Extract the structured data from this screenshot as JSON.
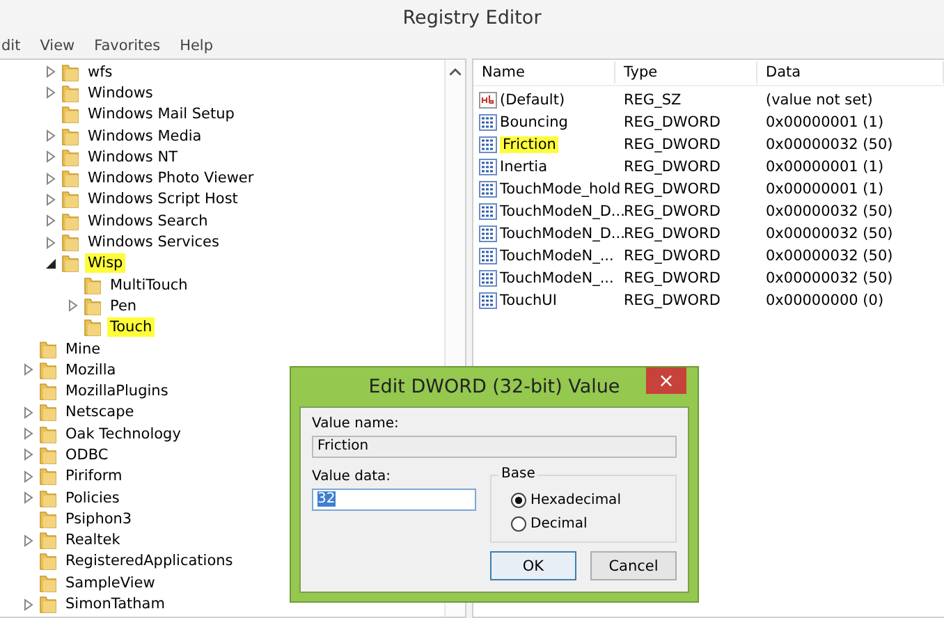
{
  "window": {
    "title": "Registry Editor"
  },
  "menu": [
    "dit",
    "View",
    "Favorites",
    "Help"
  ],
  "tree": {
    "continued_children": [
      {
        "label": "wfs",
        "expanded": false,
        "highlighted": false
      },
      {
        "label": "Windows",
        "expanded": false,
        "highlighted": false
      },
      {
        "label": "Windows Mail Setup",
        "highlighted": false
      },
      {
        "label": "Windows Media",
        "expanded": false,
        "highlighted": false
      },
      {
        "label": "Windows NT",
        "expanded": false,
        "highlighted": false
      },
      {
        "label": "Windows Photo Viewer",
        "expanded": false,
        "highlighted": false
      },
      {
        "label": "Windows Script Host",
        "expanded": false,
        "highlighted": false
      },
      {
        "label": "Windows Search",
        "expanded": false,
        "highlighted": false
      },
      {
        "label": "Windows Services",
        "expanded": false,
        "highlighted": false
      },
      {
        "label": "Wisp",
        "expanded": true,
        "highlighted": true,
        "children": [
          {
            "label": "MultiTouch",
            "highlighted": false
          },
          {
            "label": "Pen",
            "expanded": false,
            "highlighted": false
          },
          {
            "label": "Touch",
            "highlighted": true
          }
        ]
      }
    ],
    "items": [
      {
        "label": "Mine",
        "highlighted": false
      },
      {
        "label": "Mozilla",
        "expanded": false,
        "highlighted": false
      },
      {
        "label": "MozillaPlugins",
        "highlighted": false
      },
      {
        "label": "Netscape",
        "expanded": false,
        "highlighted": false
      },
      {
        "label": "Oak Technology",
        "expanded": false,
        "highlighted": false
      },
      {
        "label": "ODBC",
        "expanded": false,
        "highlighted": false
      },
      {
        "label": "Piriform",
        "expanded": false,
        "highlighted": false
      },
      {
        "label": "Policies",
        "expanded": false,
        "highlighted": false
      },
      {
        "label": "Psiphon3",
        "highlighted": false
      },
      {
        "label": "Realtek",
        "expanded": false,
        "highlighted": false
      },
      {
        "label": "RegisteredApplications",
        "highlighted": false
      },
      {
        "label": "SampleView",
        "highlighted": false
      },
      {
        "label": "SimonTatham",
        "expanded": false,
        "highlighted": false
      }
    ]
  },
  "values": {
    "columns": [
      "Name",
      "Type",
      "Data"
    ],
    "rows": [
      {
        "kind": "string",
        "name": "(Default)",
        "type": "REG_SZ",
        "data": "(value not set)",
        "highlighted": false
      },
      {
        "kind": "binary",
        "name": "Bouncing",
        "type": "REG_DWORD",
        "data": "0x00000001 (1)",
        "highlighted": false
      },
      {
        "kind": "binary",
        "name": "Friction",
        "type": "REG_DWORD",
        "data": "0x00000032 (50)",
        "highlighted": true
      },
      {
        "kind": "binary",
        "name": "Inertia",
        "type": "REG_DWORD",
        "data": "0x00000001 (1)",
        "highlighted": false
      },
      {
        "kind": "binary",
        "name": "TouchMode_hold",
        "type": "REG_DWORD",
        "data": "0x00000001 (1)",
        "highlighted": false
      },
      {
        "kind": "binary",
        "name": "TouchModeN_D...",
        "type": "REG_DWORD",
        "data": "0x00000032 (50)",
        "highlighted": false
      },
      {
        "kind": "binary",
        "name": "TouchModeN_D...",
        "type": "REG_DWORD",
        "data": "0x00000032 (50)",
        "highlighted": false
      },
      {
        "kind": "binary",
        "name": "TouchModeN_...",
        "type": "REG_DWORD",
        "data": "0x00000032 (50)",
        "highlighted": false
      },
      {
        "kind": "binary",
        "name": "TouchModeN_...",
        "type": "REG_DWORD",
        "data": "0x00000032 (50)",
        "highlighted": false
      },
      {
        "kind": "binary",
        "name": "TouchUI",
        "type": "REG_DWORD",
        "data": "0x00000000 (0)",
        "highlighted": false
      }
    ]
  },
  "dialog": {
    "title": "Edit DWORD (32-bit) Value",
    "close": "×",
    "value_name_label": "Value name:",
    "value_name": "Friction",
    "value_data_label": "Value data:",
    "value_data": "32",
    "base_label": "Base",
    "base_options": [
      {
        "label": "Hexadecimal",
        "selected": true
      },
      {
        "label": "Decimal",
        "selected": false
      }
    ],
    "buttons": [
      "OK",
      "Cancel"
    ]
  }
}
